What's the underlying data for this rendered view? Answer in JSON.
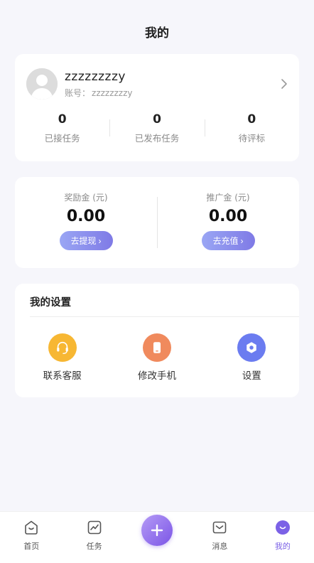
{
  "header": {
    "title": "我的"
  },
  "profile": {
    "username": "zzzzzzzzy",
    "account_label": "账号：",
    "account_value": "zzzzzzzzy",
    "stats": [
      {
        "value": "0",
        "label": "已接任务"
      },
      {
        "value": "0",
        "label": "已发布任务"
      },
      {
        "value": "0",
        "label": "待评标"
      }
    ]
  },
  "wallet": {
    "reward": {
      "label": "奖励金 (元)",
      "amount": "0.00",
      "button": "去提现"
    },
    "promo": {
      "label": "推广金 (元)",
      "amount": "0.00",
      "button": "去充值"
    }
  },
  "settings": {
    "title": "我的设置",
    "items": [
      {
        "label": "联系客服",
        "icon": "headset-icon",
        "color": "#f7b733"
      },
      {
        "label": "修改手机",
        "icon": "phone-icon",
        "color": "#f08a5d"
      },
      {
        "label": "设置",
        "icon": "gear-icon",
        "color": "#6b7cf0"
      }
    ]
  },
  "tabbar": {
    "items": [
      {
        "label": "首页",
        "icon": "home-icon"
      },
      {
        "label": "任务",
        "icon": "task-chart-icon"
      },
      {
        "label": "",
        "icon": "plus-icon"
      },
      {
        "label": "消息",
        "icon": "message-icon"
      },
      {
        "label": "我的",
        "icon": "profile-icon"
      }
    ],
    "active_color": "#7b61e6"
  },
  "colors": {
    "accent": "#7b61e6",
    "background": "#f6f6fb"
  }
}
